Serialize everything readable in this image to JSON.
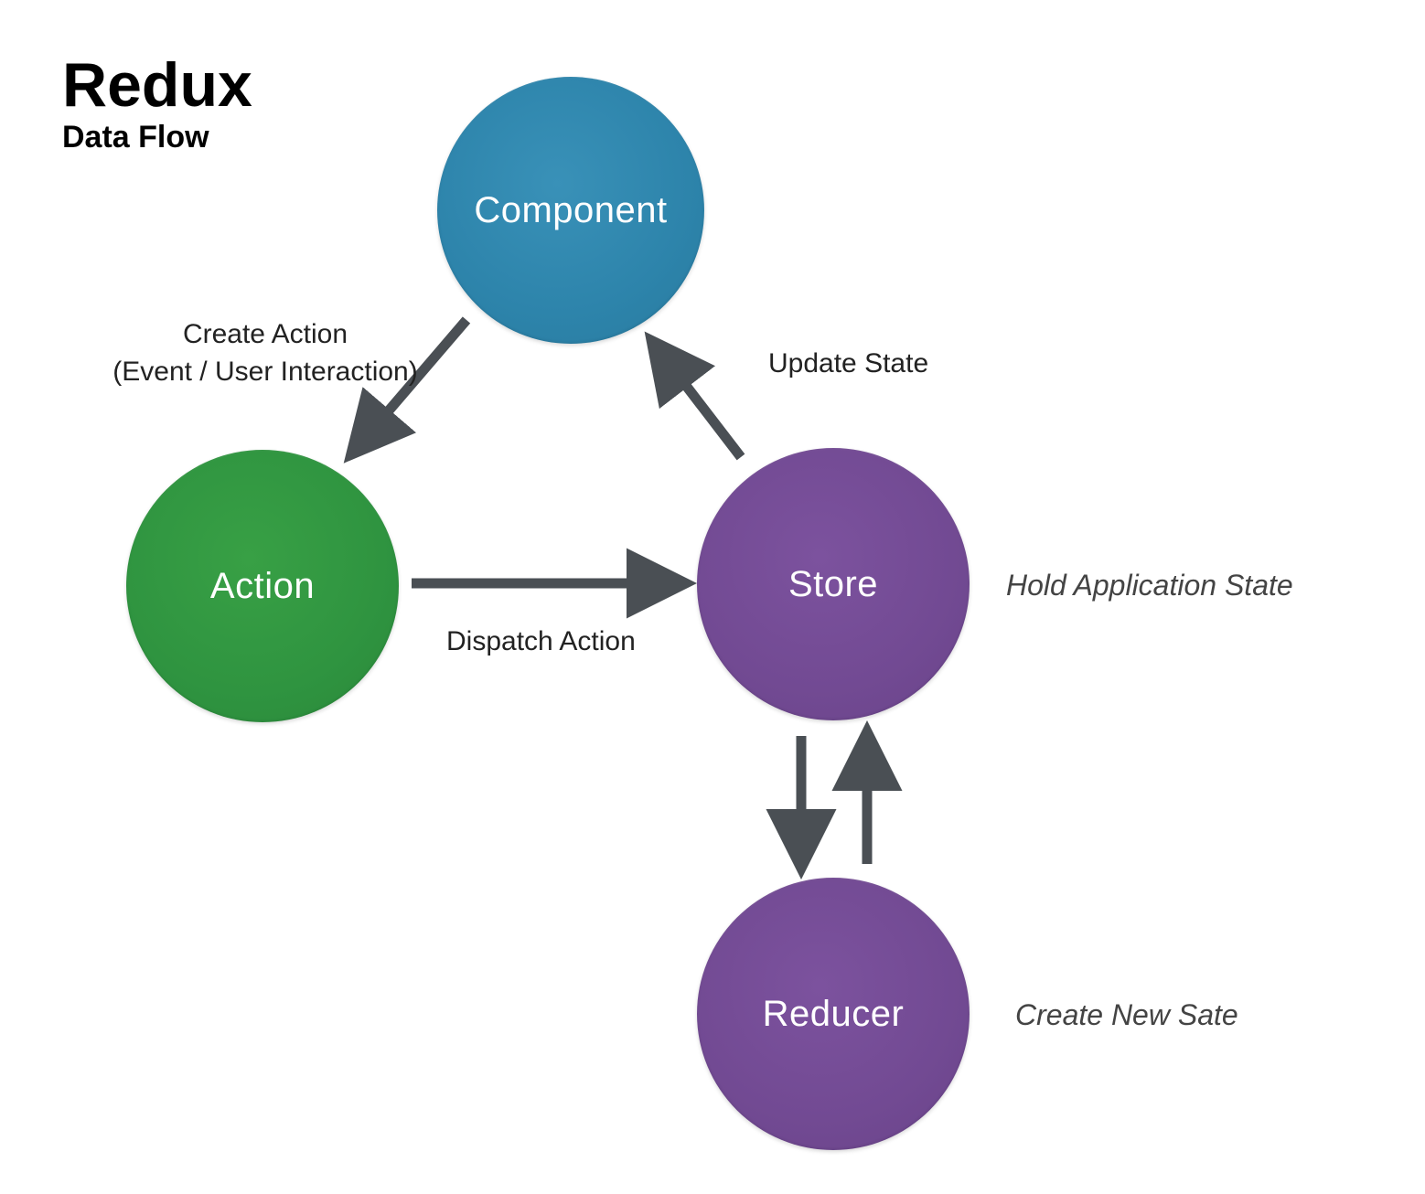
{
  "header": {
    "title": "Redux",
    "subtitle": "Data Flow"
  },
  "nodes": {
    "component": "Component",
    "action": "Action",
    "store": "Store",
    "reducer": "Reducer"
  },
  "edges": {
    "create_action_line1": "Create Action",
    "create_action_line2": "(Event / User Interaction)",
    "update_state": "Update State",
    "dispatch_action": "Dispatch Action"
  },
  "annotations": {
    "store": "Hold Application State",
    "reducer": "Create New Sate"
  },
  "colors": {
    "component": "#2d84ab",
    "action": "#2f9440",
    "store_reducer": "#724a93",
    "arrow": "#4a4f54"
  }
}
